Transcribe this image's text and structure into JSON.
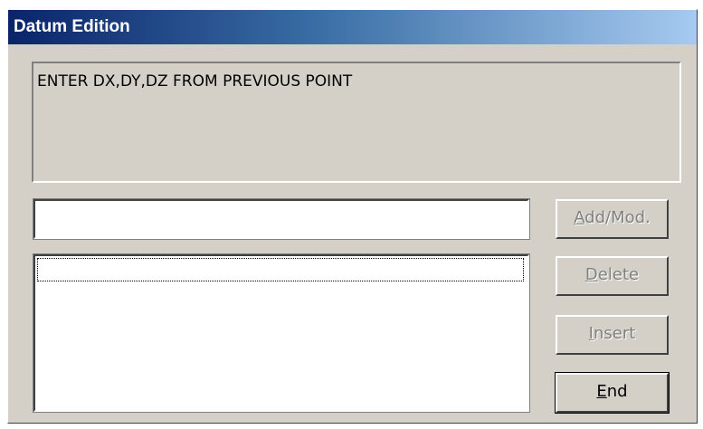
{
  "window": {
    "title": "Datum Edition"
  },
  "message": {
    "text": "ENTER DX,DY,DZ FROM PREVIOUS POINT"
  },
  "input": {
    "value": ""
  },
  "buttons": {
    "add_mod": {
      "accel": "A",
      "rest": "dd/Mod.",
      "enabled": false
    },
    "delete": {
      "accel": "D",
      "rest": "elete",
      "enabled": false
    },
    "insert": {
      "accel": "I",
      "rest": "nsert",
      "enabled": false
    },
    "end": {
      "accel": "E",
      "rest": "nd",
      "enabled": true
    }
  }
}
